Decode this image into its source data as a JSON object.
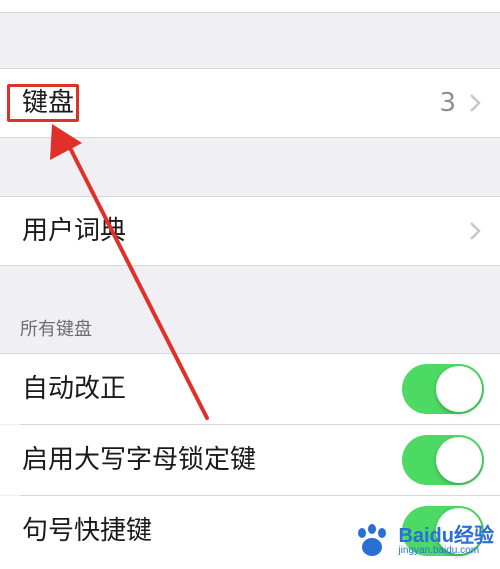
{
  "keyboard_row": {
    "label": "键盘",
    "value": "3"
  },
  "user_dictionary_row": {
    "label": "用户词典"
  },
  "section": {
    "header": "所有键盘"
  },
  "toggles": [
    {
      "label": "自动改正",
      "on": true
    },
    {
      "label": "启用大写字母锁定键",
      "on": true
    },
    {
      "label": "句号快捷键",
      "on": true
    }
  ],
  "annotation": {
    "color": "#e0302a"
  },
  "toggle_color": "#4cd964",
  "watermark": {
    "title": "Baidu经验",
    "sub": "jingyan.baidu.com"
  }
}
